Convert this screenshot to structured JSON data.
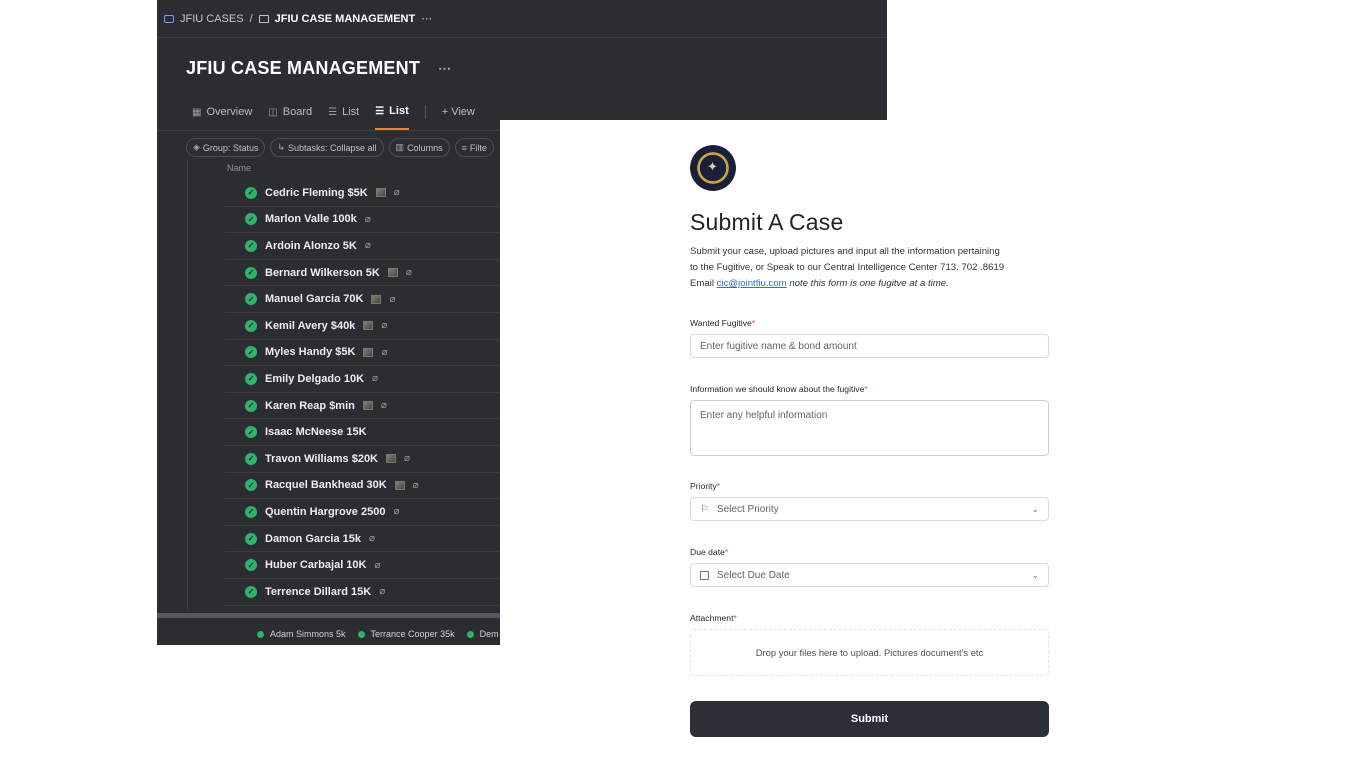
{
  "app": {
    "breadcrumb": {
      "space": "JFIU CASES",
      "separator": "/",
      "folder": "JFIU CASE MANAGEMENT",
      "more": "⋯"
    },
    "page_title": "JFIU CASE MANAGEMENT",
    "title_more": "⋯",
    "tabs": [
      {
        "label": "Overview",
        "icon": "grid-icon"
      },
      {
        "label": "Board",
        "icon": "board-icon"
      },
      {
        "label": "List",
        "icon": "list-icon"
      },
      {
        "label": "List",
        "icon": "list-icon",
        "active": true
      },
      {
        "label": "+ View",
        "icon": "plus-icon"
      }
    ],
    "toolbar": {
      "group": "Group: Status",
      "subtasks": "Subtasks: Collapse all",
      "columns": "Columns",
      "filter": "Filte"
    },
    "column_header": "Name",
    "tasks": [
      "Cedric Fleming $5K",
      "Marlon Valle 100k",
      "Ardoin Alonzo 5K",
      "Bernard Wilkerson 5K",
      "Manuel Garcia 70K",
      "Kemil Avery $40k",
      "Myles Handy $5K",
      "Emily Delgado 10K",
      "Karen Reap $min",
      "Isaac McNeese 15K",
      "Travon Williams $20K",
      "Racquel Bankhead 30K",
      "Quentin Hargrove 2500",
      "Damon Garcia 15k",
      "Huber Carbajal 10K",
      "Terrence Dillard 15K"
    ],
    "bottom_items": [
      "Adam Simmons 5k",
      "Terrance Cooper 35k",
      "Dem"
    ]
  },
  "form": {
    "title": "Submit A Case",
    "desc_line1": "Submit your case, upload pictures and input all the information pertaining",
    "desc_line2": "to the Fugitive, or Speak to our Central Intelligence Center 713. 702 .8619",
    "desc_email_prefix": "Email ",
    "desc_email": "cic@jointfiu.com",
    "desc_note": " note this form is one fugitve at a time.",
    "fugitive_label": "Wanted Fugitive",
    "fugitive_placeholder": "Enter fugitive name & bond amount",
    "info_label": "Information we should know about the fugitive",
    "info_placeholder": "Enter any helpful information",
    "priority_label": "Priority",
    "priority_placeholder": "Select Priority",
    "due_label": "Due date",
    "due_placeholder": "Select Due Date",
    "attach_label": "Attachment",
    "attach_text": "Drop your files here to upload. Pictures document's etc",
    "required_mark": "*",
    "submit": "Submit"
  },
  "colors": {
    "dark_bg": "#2b2d31",
    "status_green": "#2fb36b",
    "accent_orange": "#e58a3a",
    "submit_bg": "#2c2f36",
    "link": "#2b6fd6"
  }
}
